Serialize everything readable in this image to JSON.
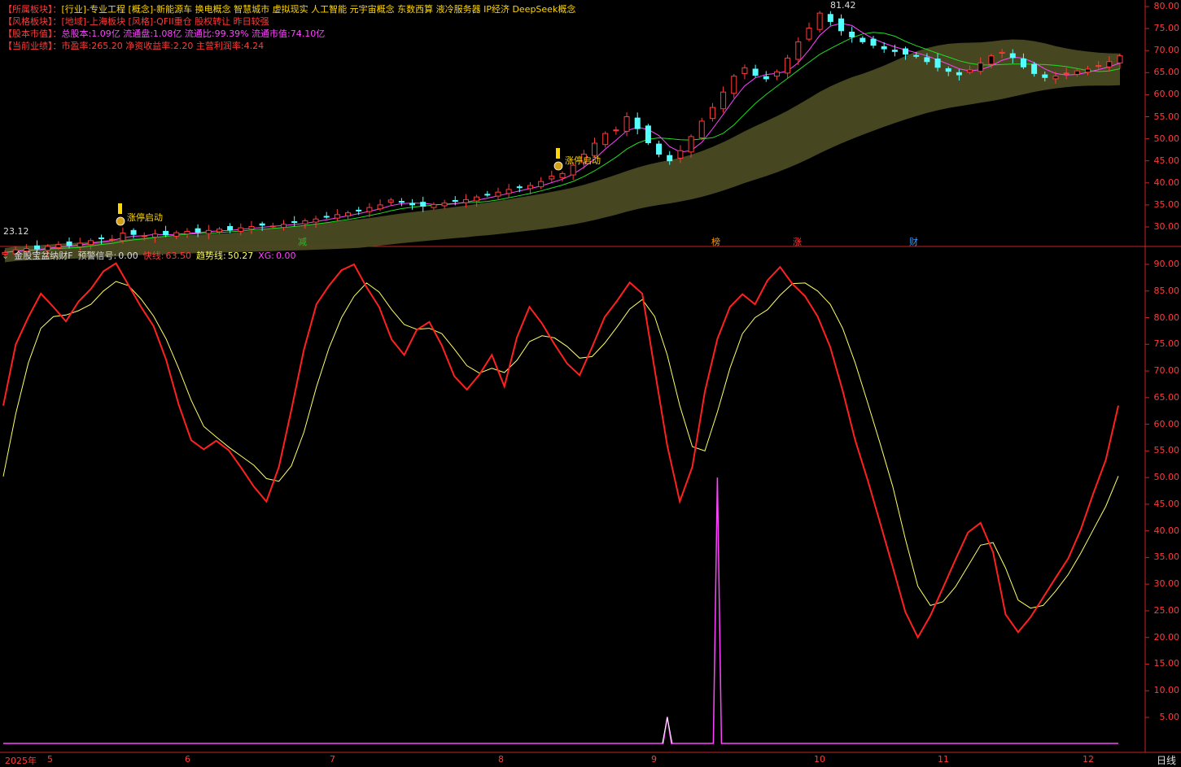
{
  "info_panel": {
    "rows": [
      {
        "key": "【所属板块】：",
        "value": "[行业]-专业工程 [概念]-新能源车 换电概念 智慧城市 虚拟现实 人工智能 元宇宙概念 东数西算 液冷服务器 IP经济 DeepSeek概念",
        "tone": "yellow"
      },
      {
        "key": "【风格板块】：",
        "value": "[地域]-上海板块 [风格]-QFII重仓 股权转让 昨日较强",
        "tone": "red"
      },
      {
        "key": "【股本市值】：",
        "value": "总股本:1.09亿 流通盘:1.08亿 流通比:99.39% 流通市值:74.10亿",
        "tone": "magenta"
      },
      {
        "key": "【当前业绩】：",
        "value": "市盈率:265.20 净资收益率:2.20 主营利润率:4.24",
        "tone": "red"
      }
    ]
  },
  "price_panel": {
    "high_label": "81.42",
    "low_label": "23.12",
    "y_ticks": [
      "80.00",
      "75.00",
      "70.00",
      "65.00",
      "60.00",
      "55.00",
      "50.00",
      "45.00",
      "40.00",
      "35.00",
      "30.00"
    ],
    "y_values": [
      80,
      75,
      70,
      65,
      60,
      55,
      50,
      45,
      40,
      35,
      30
    ],
    "signals": [
      "涨停启动",
      "涨停启动"
    ],
    "event_markers": [
      {
        "text": "减",
        "color": "#20c020"
      },
      {
        "text": "榜",
        "color": "#ff9900"
      },
      {
        "text": "涨",
        "color": "#ff3b3b"
      },
      {
        "text": "财",
        "color": "#3399ff"
      }
    ]
  },
  "indicator_panel": {
    "name": "金股宝盆纳财F",
    "warn_label": "预警信号:",
    "warn_value": "0.00",
    "fast_label": "快线:",
    "fast_value": "63.50",
    "trend_label": "趋势线:",
    "trend_value": "50.27",
    "xg_label": "XG:",
    "xg_value": "0.00",
    "y_ticks": [
      "90.00",
      "85.00",
      "80.00",
      "75.00",
      "70.00",
      "65.00",
      "60.00",
      "55.00",
      "50.00",
      "45.00",
      "40.00",
      "35.00",
      "30.00",
      "25.00",
      "20.00",
      "15.00",
      "10.00",
      "5.00"
    ],
    "y_values": [
      90,
      85,
      80,
      75,
      70,
      65,
      60,
      55,
      50,
      45,
      40,
      35,
      30,
      25,
      20,
      15,
      10,
      5
    ]
  },
  "x_axis": {
    "year_label": "2025年",
    "months": [
      "5",
      "6",
      "7",
      "8",
      "9",
      "10",
      "11",
      "12"
    ],
    "period_label": "日线"
  },
  "colors": {
    "up": "#ff3b3b",
    "down": "#54ffff",
    "fast_line": "#ff2020",
    "trend_line": "#ffff66",
    "warn_line": "#ff44ff",
    "band": "#4a4a22",
    "grid_border": "#cc2222"
  },
  "chart_data": [
    {
      "type": "candlestick",
      "title": "",
      "ylim": [
        22,
        82
      ],
      "high": 81.42,
      "low": 23.12,
      "close": [
        24.2,
        24.8,
        25.1,
        25.0,
        25.6,
        26.0,
        25.8,
        26.3,
        26.9,
        27.4,
        27.2,
        28.6,
        28.3,
        28.0,
        28.4,
        28.2,
        28.7,
        29.0,
        28.8,
        29.2,
        29.5,
        29.3,
        29.8,
        30.1,
        30.4,
        30.2,
        30.6,
        31.0,
        31.4,
        31.8,
        32.3,
        32.8,
        33.2,
        33.8,
        34.4,
        35.0,
        36.1,
        35.6,
        35.0,
        34.7,
        35.1,
        35.4,
        35.8,
        36.2,
        36.8,
        37.3,
        37.9,
        38.5,
        39.0,
        39.4,
        40.3,
        41.5,
        42.1,
        44.0,
        46.5,
        49.0,
        51.2,
        52.0,
        55.0,
        52.3,
        49.1,
        46.5,
        45.0,
        47.3,
        50.5,
        54.0,
        57.1,
        60.6,
        64.2,
        66.1,
        64.4,
        63.6,
        65.2,
        68.3,
        72.0,
        75.1,
        78.5,
        76.6,
        74.5,
        73.1,
        72.0,
        71.2,
        70.4,
        69.8,
        69.2,
        68.7,
        67.5,
        66.2,
        65.3,
        64.5,
        65.6,
        67.2,
        68.8,
        69.6,
        68.4,
        66.3,
        64.8,
        63.9,
        64.2,
        64.9,
        65.4,
        65.8,
        66.6,
        67.5,
        68.8
      ]
    },
    {
      "type": "line",
      "title": "金股宝盆纳财F",
      "ylim": [
        0,
        92
      ],
      "series": [
        {
          "name": "快线",
          "values": [
            63.5,
            75.0,
            80.1,
            84.5,
            82.0,
            79.3,
            83.0,
            85.4,
            88.7,
            90.2,
            86.1,
            82.0,
            78.4,
            72.1,
            63.7,
            57.0,
            55.3,
            56.9,
            55.1,
            51.8,
            48.3,
            45.5,
            52.0,
            62.7,
            74.0,
            82.5,
            86.0,
            88.9,
            90.0,
            85.7,
            82.0,
            75.9,
            73.0,
            77.7,
            79.2,
            74.8,
            69.0,
            66.5,
            69.3,
            73.0,
            67.1,
            76.3,
            82.0,
            78.9,
            75.0,
            71.4,
            69.2,
            74.5,
            80.1,
            83.2,
            86.6,
            84.5,
            70.2,
            56.0,
            45.5,
            52.0,
            66.1,
            76.0,
            82.0,
            84.4,
            82.5,
            87.0,
            89.5,
            86.3,
            84.0,
            80.2,
            74.5,
            66.3,
            57.0,
            49.5,
            41.4,
            33.2,
            24.8,
            20.0,
            24.1,
            29.3,
            34.6,
            39.7,
            41.5,
            36.0,
            24.3,
            21.0,
            23.8,
            27.5,
            31.2,
            34.8,
            40.2,
            47.0,
            53.3,
            63.5
          ]
        },
        {
          "name": "趋势线",
          "values": [
            50.2,
            62.0,
            71.5,
            78.0,
            80.2,
            80.5,
            81.3,
            82.5,
            85.0,
            86.8,
            86.0,
            83.5,
            80.3,
            76.0,
            70.5,
            64.5,
            59.6,
            57.6,
            55.7,
            54.0,
            52.3,
            49.8,
            49.3,
            52.2,
            58.5,
            67.0,
            74.3,
            80.0,
            84.0,
            86.5,
            84.8,
            81.5,
            78.7,
            77.8,
            78.0,
            77.0,
            74.1,
            71.0,
            69.6,
            70.5,
            69.7,
            72.0,
            75.5,
            76.6,
            76.2,
            74.6,
            72.4,
            72.7,
            75.2,
            78.3,
            81.6,
            83.4,
            80.2,
            73.0,
            63.5,
            55.8,
            55.0,
            62.3,
            70.5,
            77.0,
            80.0,
            81.5,
            84.2,
            86.4,
            86.5,
            85.0,
            82.5,
            78.0,
            71.5,
            64.0,
            56.3,
            48.3,
            38.5,
            29.6,
            26.0,
            26.7,
            29.5,
            33.4,
            37.3,
            37.8,
            33.0,
            27.0,
            25.5,
            26.0,
            28.7,
            31.8,
            35.8,
            40.2,
            44.6,
            50.27
          ]
        },
        {
          "name": "预警信号",
          "values": [
            0,
            0,
            0,
            0,
            0,
            0,
            0,
            0,
            0,
            0,
            0,
            0,
            0,
            0,
            0,
            0,
            0,
            0,
            0,
            0,
            0,
            0,
            0,
            0,
            0,
            0,
            0,
            0,
            0,
            0,
            0,
            0,
            0,
            0,
            0,
            0,
            0,
            0,
            0,
            0,
            0,
            0,
            0,
            0,
            0,
            0,
            0,
            0,
            0,
            0,
            0,
            0,
            0,
            5,
            0,
            0,
            0,
            50,
            0,
            0,
            0,
            0,
            0,
            0,
            0,
            0,
            0,
            0,
            0,
            0,
            0,
            0,
            0,
            0,
            0,
            0,
            0,
            0,
            0,
            0,
            0,
            0,
            0,
            0,
            0,
            0,
            0,
            0,
            0,
            0
          ]
        }
      ]
    }
  ]
}
